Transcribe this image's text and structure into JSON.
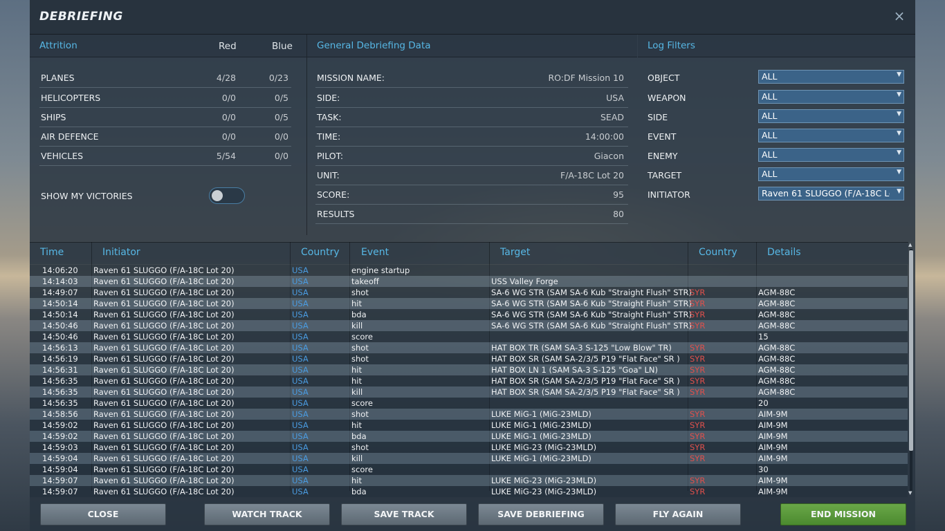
{
  "title": "DEBRIEFING",
  "close_glyph": "×",
  "attrition": {
    "title": "Attrition",
    "col_red": "Red",
    "col_blue": "Blue",
    "rows": [
      {
        "label": "PLANES",
        "red": "4/28",
        "blue": "0/23"
      },
      {
        "label": "HELICOPTERS",
        "red": "0/0",
        "blue": "0/5"
      },
      {
        "label": "SHIPS",
        "red": "0/0",
        "blue": "0/5"
      },
      {
        "label": "AIR DEFENCE",
        "red": "0/0",
        "blue": "0/0"
      },
      {
        "label": "VEHICLES",
        "red": "5/54",
        "blue": "0/0"
      }
    ],
    "show_victories_label": "SHOW MY VICTORIES",
    "show_victories_on": false
  },
  "general": {
    "title": "General Debriefing Data",
    "rows": [
      {
        "label": "MISSION NAME:",
        "value": "RO:DF Mission 10"
      },
      {
        "label": "SIDE:",
        "value": "USA"
      },
      {
        "label": "TASK:",
        "value": "SEAD"
      },
      {
        "label": "TIME:",
        "value": "14:00:00"
      },
      {
        "label": "PILOT:",
        "value": "Giacon"
      },
      {
        "label": "UNIT:",
        "value": "F/A-18C Lot 20"
      },
      {
        "label": "SCORE:",
        "value": "95"
      },
      {
        "label": "RESULTS",
        "value": "80"
      }
    ]
  },
  "filters": {
    "title": "Log Filters",
    "rows": [
      {
        "label": "OBJECT",
        "value": "ALL"
      },
      {
        "label": "WEAPON",
        "value": "ALL"
      },
      {
        "label": "SIDE",
        "value": "ALL"
      },
      {
        "label": "EVENT",
        "value": "ALL"
      },
      {
        "label": "ENEMY",
        "value": "ALL"
      },
      {
        "label": "TARGET",
        "value": "ALL"
      },
      {
        "label": "INITIATOR",
        "value": "Raven 61 SLUGGO (F/A-18C Lot"
      }
    ]
  },
  "log": {
    "columns": [
      "Time",
      "Initiator",
      "Country",
      "Event",
      "Target",
      "Country",
      "Details"
    ],
    "rows": [
      {
        "time": "14:06:20",
        "initiator": "Raven 61 SLUGGO (F/A-18C Lot 20)",
        "country": "USA",
        "event": "engine startup",
        "target": "",
        "target_country": "",
        "details": ""
      },
      {
        "time": "14:14:03",
        "initiator": "Raven 61 SLUGGO (F/A-18C Lot 20)",
        "country": "USA",
        "event": "takeoff",
        "target": "USS Valley Forge",
        "target_country": "",
        "details": ""
      },
      {
        "time": "14:49:07",
        "initiator": "Raven 61 SLUGGO (F/A-18C Lot 20)",
        "country": "USA",
        "event": "shot",
        "target": "SA-6 WG STR (SAM SA-6 Kub \"Straight Flush\" STR)",
        "target_country": "SYR",
        "details": "AGM-88C"
      },
      {
        "time": "14:50:14",
        "initiator": "Raven 61 SLUGGO (F/A-18C Lot 20)",
        "country": "USA",
        "event": "hit",
        "target": "SA-6 WG STR (SAM SA-6 Kub \"Straight Flush\" STR)",
        "target_country": "SYR",
        "details": "AGM-88C"
      },
      {
        "time": "14:50:14",
        "initiator": "Raven 61 SLUGGO (F/A-18C Lot 20)",
        "country": "USA",
        "event": "bda",
        "target": "SA-6 WG STR (SAM SA-6 Kub \"Straight Flush\" STR)",
        "target_country": "SYR",
        "details": "AGM-88C"
      },
      {
        "time": "14:50:46",
        "initiator": "Raven 61 SLUGGO (F/A-18C Lot 20)",
        "country": "USA",
        "event": "kill",
        "target": "SA-6 WG STR (SAM SA-6 Kub \"Straight Flush\" STR)",
        "target_country": "SYR",
        "details": "AGM-88C"
      },
      {
        "time": "14:50:46",
        "initiator": "Raven 61 SLUGGO (F/A-18C Lot 20)",
        "country": "USA",
        "event": "score",
        "target": "",
        "target_country": "",
        "details": "15"
      },
      {
        "time": "14:56:13",
        "initiator": "Raven 61 SLUGGO (F/A-18C Lot 20)",
        "country": "USA",
        "event": "shot",
        "target": "HAT BOX TR (SAM SA-3 S-125 \"Low Blow\" TR)",
        "target_country": "SYR",
        "details": "AGM-88C"
      },
      {
        "time": "14:56:19",
        "initiator": "Raven 61 SLUGGO (F/A-18C Lot 20)",
        "country": "USA",
        "event": "shot",
        "target": "HAT BOX SR (SAM SA-2/3/5 P19 \"Flat Face\" SR )",
        "target_country": "SYR",
        "details": "AGM-88C"
      },
      {
        "time": "14:56:31",
        "initiator": "Raven 61 SLUGGO (F/A-18C Lot 20)",
        "country": "USA",
        "event": "hit",
        "target": "HAT BOX LN 1 (SAM SA-3 S-125 \"Goa\" LN)",
        "target_country": "SYR",
        "details": "AGM-88C"
      },
      {
        "time": "14:56:35",
        "initiator": "Raven 61 SLUGGO (F/A-18C Lot 20)",
        "country": "USA",
        "event": "hit",
        "target": "HAT BOX SR (SAM SA-2/3/5 P19 \"Flat Face\" SR )",
        "target_country": "SYR",
        "details": "AGM-88C"
      },
      {
        "time": "14:56:35",
        "initiator": "Raven 61 SLUGGO (F/A-18C Lot 20)",
        "country": "USA",
        "event": "kill",
        "target": "HAT BOX SR (SAM SA-2/3/5 P19 \"Flat Face\" SR )",
        "target_country": "SYR",
        "details": "AGM-88C"
      },
      {
        "time": "14:56:35",
        "initiator": "Raven 61 SLUGGO (F/A-18C Lot 20)",
        "country": "USA",
        "event": "score",
        "target": "",
        "target_country": "",
        "details": "20"
      },
      {
        "time": "14:58:56",
        "initiator": "Raven 61 SLUGGO (F/A-18C Lot 20)",
        "country": "USA",
        "event": "shot",
        "target": "LUKE MiG-1 (MiG-23MLD)",
        "target_country": "SYR",
        "details": "AIM-9M"
      },
      {
        "time": "14:59:02",
        "initiator": "Raven 61 SLUGGO (F/A-18C Lot 20)",
        "country": "USA",
        "event": "hit",
        "target": "LUKE MiG-1 (MiG-23MLD)",
        "target_country": "SYR",
        "details": "AIM-9M"
      },
      {
        "time": "14:59:02",
        "initiator": "Raven 61 SLUGGO (F/A-18C Lot 20)",
        "country": "USA",
        "event": "bda",
        "target": "LUKE MiG-1 (MiG-23MLD)",
        "target_country": "SYR",
        "details": "AIM-9M"
      },
      {
        "time": "14:59:03",
        "initiator": "Raven 61 SLUGGO (F/A-18C Lot 20)",
        "country": "USA",
        "event": "shot",
        "target": "LUKE MiG-23 (MiG-23MLD)",
        "target_country": "SYR",
        "details": "AIM-9M"
      },
      {
        "time": "14:59:04",
        "initiator": "Raven 61 SLUGGO (F/A-18C Lot 20)",
        "country": "USA",
        "event": "kill",
        "target": "LUKE MiG-1 (MiG-23MLD)",
        "target_country": "SYR",
        "details": "AIM-9M"
      },
      {
        "time": "14:59:04",
        "initiator": "Raven 61 SLUGGO (F/A-18C Lot 20)",
        "country": "USA",
        "event": "score",
        "target": "",
        "target_country": "",
        "details": "30"
      },
      {
        "time": "14:59:07",
        "initiator": "Raven 61 SLUGGO (F/A-18C Lot 20)",
        "country": "USA",
        "event": "hit",
        "target": "LUKE MiG-23 (MiG-23MLD)",
        "target_country": "SYR",
        "details": "AIM-9M"
      },
      {
        "time": "14:59:07",
        "initiator": "Raven 61 SLUGGO (F/A-18C Lot 20)",
        "country": "USA",
        "event": "bda",
        "target": "LUKE MiG-23 (MiG-23MLD)",
        "target_country": "SYR",
        "details": "AIM-9M"
      }
    ]
  },
  "buttons": {
    "close": "CLOSE",
    "watch_track": "WATCH TRACK",
    "save_track": "SAVE TRACK",
    "save_debriefing": "SAVE DEBRIEFING",
    "fly_again": "FLY AGAIN",
    "end_mission": "END MISSION"
  },
  "colors": {
    "accent": "#57b8e6",
    "own_country": "#4a9be0",
    "enemy_country": "#e0504c",
    "end_mission": "#5b9a3a"
  }
}
